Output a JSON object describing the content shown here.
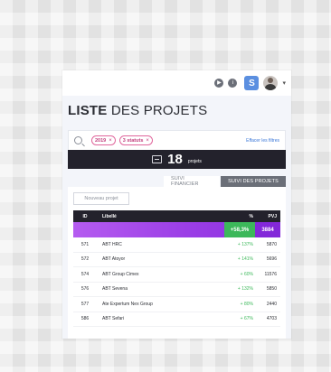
{
  "header": {
    "app_badge": "S",
    "caret": "▾"
  },
  "page": {
    "title_bold": "LISTE",
    "title_rest": " DES PROJETS"
  },
  "filters": {
    "chips": [
      {
        "label": "2019",
        "remove": "×"
      },
      {
        "label": "3 statuts",
        "remove": "×"
      }
    ],
    "clear_label": "Effacer les filtres"
  },
  "summary_bar": {
    "count": "18",
    "count_label": "projets"
  },
  "tabs": [
    {
      "label": "SUIVI FINANCIER",
      "active": false
    },
    {
      "label": "SUIVI DES PROJETS",
      "active": true
    }
  ],
  "table": {
    "new_button": "Nouveau projet",
    "headers": {
      "id": "ID",
      "libelle": "Libellé",
      "pct": "%",
      "pvj": "PVJ"
    },
    "totals": {
      "pct": "+58,3%",
      "pvj": "3884"
    },
    "rows": [
      {
        "id": "571",
        "libelle": "ABT HRC",
        "pct": "+ 137%",
        "pvj": "5870"
      },
      {
        "id": "572",
        "libelle": "ABT Atoyor",
        "pct": "+ 141%",
        "pvj": "5696"
      },
      {
        "id": "574",
        "libelle": "ABT Group Cimex",
        "pct": "+ 60%",
        "pvj": "11576"
      },
      {
        "id": "576",
        "libelle": "ABT Sevena",
        "pct": "+ 132%",
        "pvj": "5850"
      },
      {
        "id": "577",
        "libelle": "Ate Expertum Nex Group",
        "pct": "+ 80%",
        "pvj": "2440"
      },
      {
        "id": "586",
        "libelle": "ABT Sefari",
        "pct": "+ 67%",
        "pvj": "4703"
      }
    ]
  },
  "colors": {
    "accent_purple": "#9b3ee6",
    "positive_green": "#3cb85a",
    "dark_bar": "#23222c",
    "badge_blue": "#5b8fe0"
  }
}
